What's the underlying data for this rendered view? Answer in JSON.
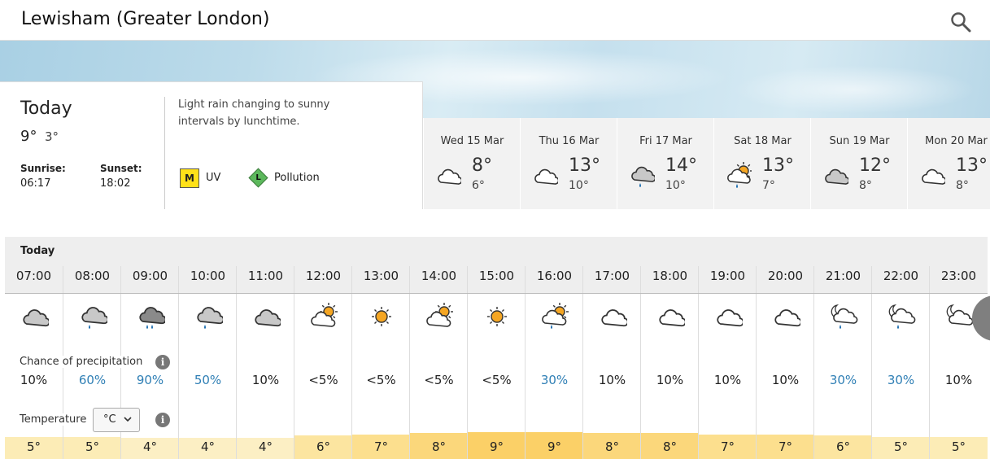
{
  "header": {
    "location": "Lewisham (Greater London)"
  },
  "today": {
    "title": "Today",
    "high": "9°",
    "low": "3°",
    "sunrise_label": "Sunrise:",
    "sunrise": "06:17",
    "sunset_label": "Sunset:",
    "sunset": "18:02",
    "summary": "Light rain changing to sunny intervals by lunchtime.",
    "uv_letter": "M",
    "uv_label": "UV",
    "pollution_letter": "L",
    "pollution_label": "Pollution"
  },
  "days": [
    {
      "name": "Wed 15 Mar",
      "high": "8°",
      "low": "6°",
      "icon": "cloud-icon"
    },
    {
      "name": "Thu 16 Mar",
      "high": "13°",
      "low": "10°",
      "icon": "cloud-icon"
    },
    {
      "name": "Fri 17 Mar",
      "high": "14°",
      "low": "10°",
      "icon": "light-rain-icon"
    },
    {
      "name": "Sat 18 Mar",
      "high": "13°",
      "low": "7°",
      "icon": "sunny-shower-icon"
    },
    {
      "name": "Sun 19 Mar",
      "high": "12°",
      "low": "8°",
      "icon": "grey-cloud-icon"
    },
    {
      "name": "Mon 20 Mar",
      "high": "13°",
      "low": "8°",
      "icon": "cloud-icon"
    }
  ],
  "hourly": {
    "label": "Today",
    "precip_label": "Chance of precipitation",
    "temp_label": "Temperature",
    "unit": "°C",
    "hours": [
      {
        "time": "07:00",
        "icon": "grey-cloud",
        "chance": "10%",
        "temp": "5°",
        "level": 5
      },
      {
        "time": "08:00",
        "icon": "light-rain",
        "chance": "60%",
        "temp": "5°",
        "level": 5
      },
      {
        "time": "09:00",
        "icon": "heavy-rain",
        "chance": "90%",
        "temp": "4°",
        "level": 4
      },
      {
        "time": "10:00",
        "icon": "light-rain",
        "chance": "50%",
        "temp": "4°",
        "level": 4
      },
      {
        "time": "11:00",
        "icon": "grey-cloud",
        "chance": "10%",
        "temp": "4°",
        "level": 4
      },
      {
        "time": "12:00",
        "icon": "sun-cloud",
        "chance": "<5%",
        "temp": "6°",
        "level": 6
      },
      {
        "time": "13:00",
        "icon": "sun",
        "chance": "<5%",
        "temp": "7°",
        "level": 7
      },
      {
        "time": "14:00",
        "icon": "sun-cloud",
        "chance": "<5%",
        "temp": "8°",
        "level": 8
      },
      {
        "time": "15:00",
        "icon": "sun",
        "chance": "<5%",
        "temp": "9°",
        "level": 9
      },
      {
        "time": "16:00",
        "icon": "sun-shower",
        "chance": "30%",
        "temp": "9°",
        "level": 9
      },
      {
        "time": "17:00",
        "icon": "white-cloud",
        "chance": "10%",
        "temp": "8°",
        "level": 8
      },
      {
        "time": "18:00",
        "icon": "white-cloud",
        "chance": "10%",
        "temp": "8°",
        "level": 8
      },
      {
        "time": "19:00",
        "icon": "white-cloud",
        "chance": "10%",
        "temp": "7°",
        "level": 7
      },
      {
        "time": "20:00",
        "icon": "white-cloud",
        "chance": "10%",
        "temp": "7°",
        "level": 7
      },
      {
        "time": "21:00",
        "icon": "night-shower",
        "chance": "30%",
        "temp": "6°",
        "level": 6
      },
      {
        "time": "22:00",
        "icon": "night-shower",
        "chance": "30%",
        "temp": "5°",
        "level": 5
      },
      {
        "time": "23:00",
        "icon": "night-cloud",
        "chance": "10%",
        "temp": "5°",
        "level": 5
      }
    ]
  },
  "colors": {
    "precip_blue": "#2f7fb5",
    "temp_colors": {
      "4": "#fcefc4",
      "5": "#fcecb6",
      "6": "#fce5a0",
      "7": "#fcdf8e",
      "8": "#fbd77b",
      "9": "#fbd067"
    }
  }
}
